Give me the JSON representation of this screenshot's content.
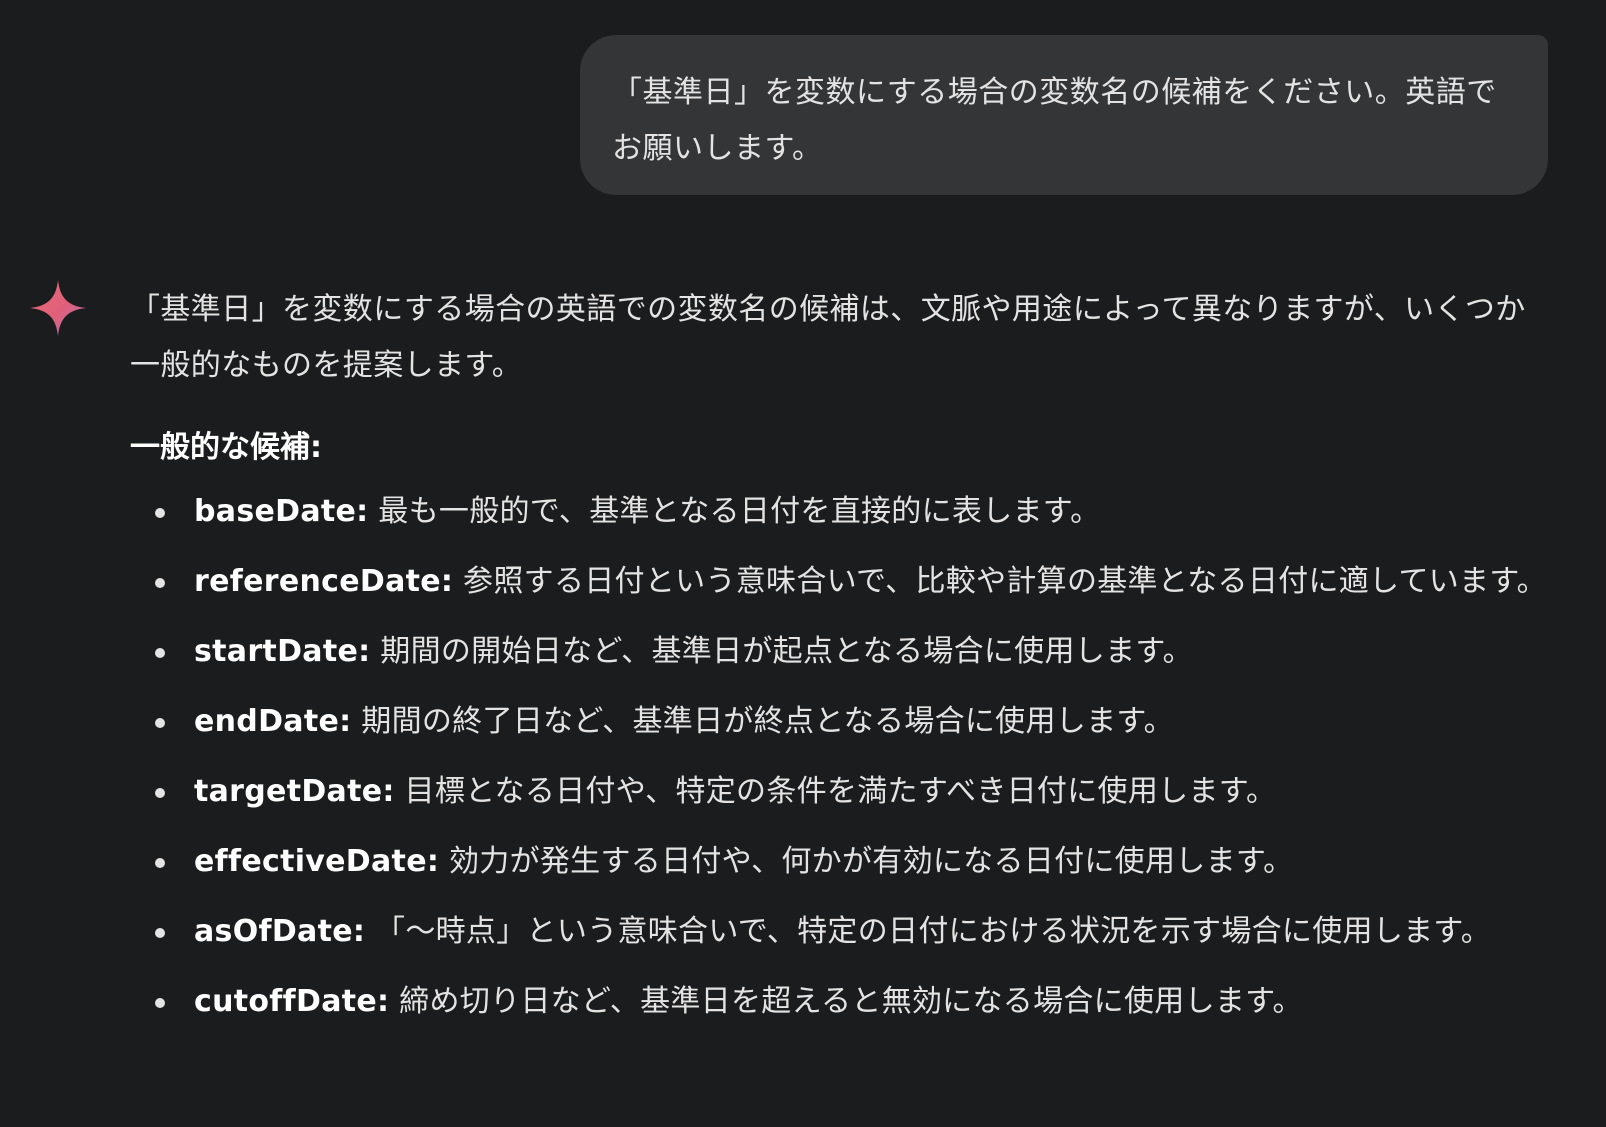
{
  "user_message": {
    "text": "「基準日」を変数にする場合の変数名の候補をください。英語でお願いします。"
  },
  "response": {
    "intro": "「基準日」を変数にする場合の英語での変数名の候補は、文脈や用途によって異なりますが、いくつか一般的なものを提案します。",
    "section_heading": "一般的な候補:",
    "items": [
      {
        "term": "baseDate:",
        "description": "最も一般的で、基準となる日付を直接的に表します。"
      },
      {
        "term": "referenceDate:",
        "description": "参照する日付という意味合いで、比較や計算の基準となる日付に適しています。"
      },
      {
        "term": "startDate:",
        "description": "期間の開始日など、基準日が起点となる場合に使用します。"
      },
      {
        "term": "endDate:",
        "description": "期間の終了日など、基準日が終点となる場合に使用します。"
      },
      {
        "term": "targetDate:",
        "description": "目標となる日付や、特定の条件を満たすべき日付に使用します。"
      },
      {
        "term": "effectiveDate:",
        "description": "効力が発生する日付や、何かが有効になる日付に使用します。"
      },
      {
        "term": "asOfDate:",
        "description": "「〜時点」という意味合いで、特定の日付における状況を示す場合に使用します。"
      },
      {
        "term": "cutoffDate:",
        "description": "締め切り日など、基準日を超えると無効になる場合に使用します。"
      }
    ]
  },
  "icons": {
    "assistant": "gemini-sparkle-icon"
  },
  "colors": {
    "background": "#1b1c1d",
    "user_bubble": "#333537",
    "text": "#e3e3e3",
    "sparkle_start": "#f06a6a",
    "sparkle_end": "#9b72cb"
  }
}
